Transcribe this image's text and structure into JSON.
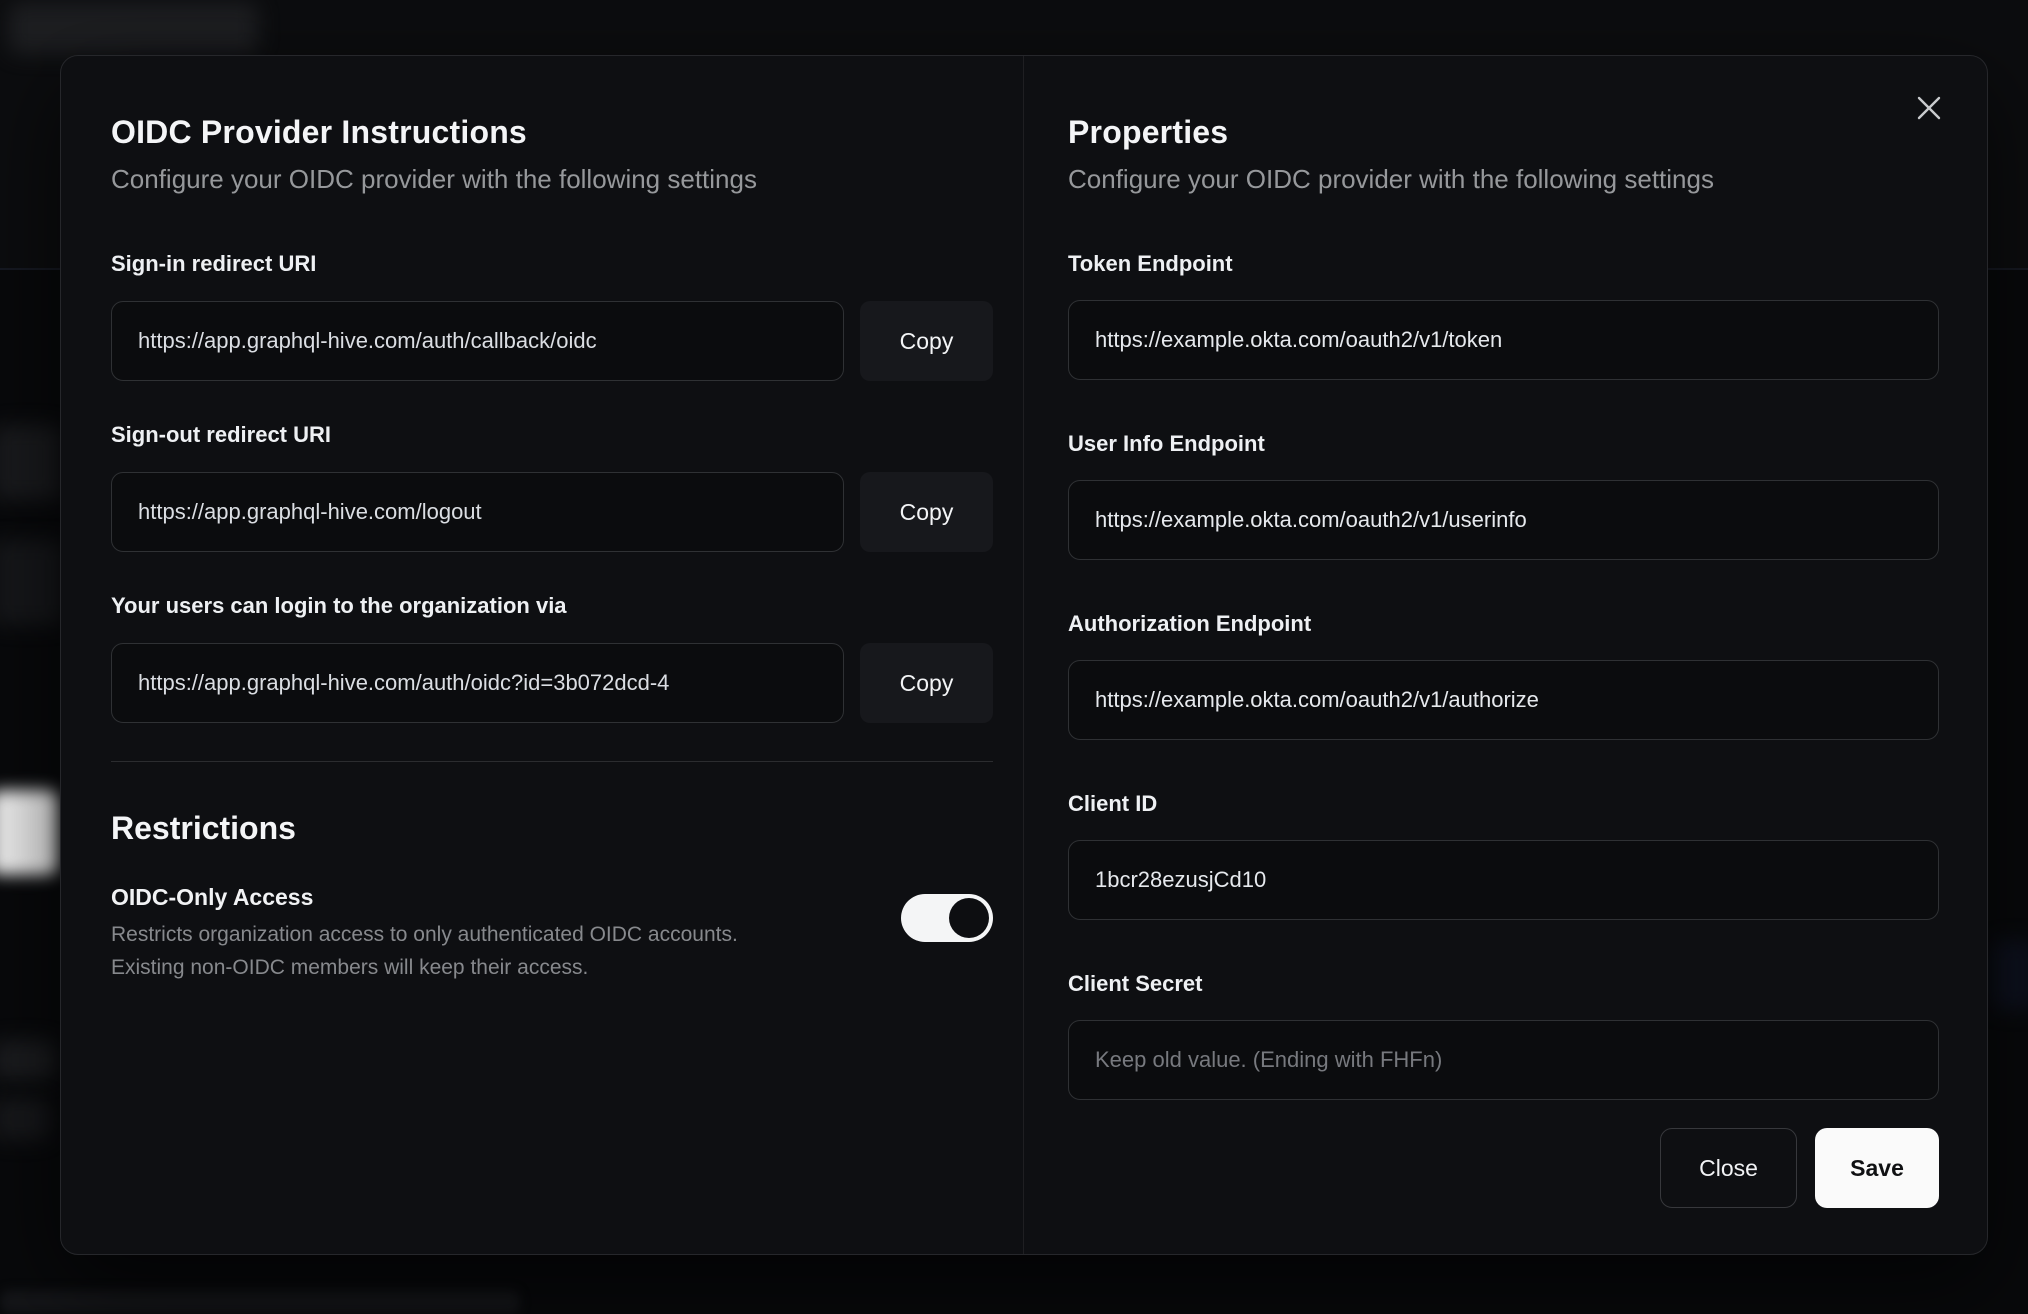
{
  "modal": {
    "close_icon": "✕",
    "left": {
      "title": "OIDC Provider Instructions",
      "subtitle": "Configure your OIDC provider with the following settings",
      "fields": [
        {
          "label": "Sign-in redirect URI",
          "value": "https://app.graphql-hive.com/auth/callback/oidc",
          "copy_label": "Copy"
        },
        {
          "label": "Sign-out redirect URI",
          "value": "https://app.graphql-hive.com/logout",
          "copy_label": "Copy"
        },
        {
          "label": "Your users can login to the organization via",
          "value": "https://app.graphql-hive.com/auth/oidc?id=3b072dcd-4",
          "copy_label": "Copy"
        }
      ],
      "restrictions": {
        "title": "Restrictions",
        "toggle_label": "OIDC-Only Access",
        "toggle_description_line1": "Restricts organization access to only authenticated OIDC accounts.",
        "toggle_description_line2": "Existing non-OIDC members will keep their access.",
        "toggle_state": "on"
      }
    },
    "right": {
      "title": "Properties",
      "subtitle": "Configure your OIDC provider with the following settings",
      "fields": [
        {
          "label": "Token Endpoint",
          "value": "https://example.okta.com/oauth2/v1/token"
        },
        {
          "label": "User Info Endpoint",
          "value": "https://example.okta.com/oauth2/v1/userinfo"
        },
        {
          "label": "Authorization Endpoint",
          "value": "https://example.okta.com/oauth2/v1/authorize"
        },
        {
          "label": "Client ID",
          "value": "1bcr28ezusjCd10"
        },
        {
          "label": "Client Secret",
          "value": "",
          "placeholder": "Keep old value. (Ending with FHFn)"
        }
      ],
      "actions": {
        "close_label": "Close",
        "save_label": "Save"
      }
    },
    "colors": {
      "modal_bg": "#0e0f12",
      "input_border": "#2f3134",
      "accent_button": "#fafafa",
      "muted_text": "#96989b"
    }
  }
}
